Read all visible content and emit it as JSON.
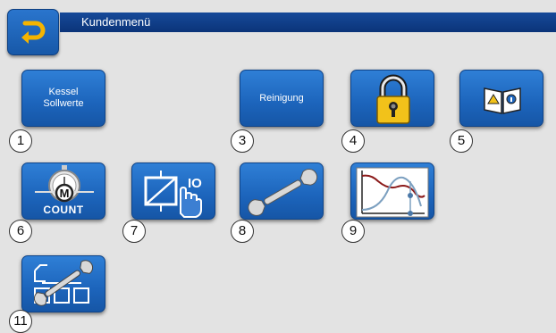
{
  "header": {
    "title": "Kundenmenü",
    "back_icon": "return-arrow-icon"
  },
  "tiles": [
    {
      "label": "Kessel\nSollwerte",
      "number": "1",
      "icon": null
    },
    {
      "label": "Reinigung",
      "number": "3",
      "icon": null
    },
    {
      "label": "",
      "number": "4",
      "icon": "padlock-icon"
    },
    {
      "label": "",
      "number": "5",
      "icon": "manual-book-icon"
    },
    {
      "label": "COUNT",
      "number": "6",
      "icon": "stopwatch-counter-icon",
      "badge": "M"
    },
    {
      "label": "IO",
      "number": "7",
      "icon": "relay-touch-icon"
    },
    {
      "label": "",
      "number": "8",
      "icon": "wrench-icon"
    },
    {
      "label": "",
      "number": "9",
      "icon": "curve-chart-icon"
    },
    {
      "label": "",
      "number": "11",
      "icon": "network-wrench-icon"
    }
  ],
  "colors": {
    "tile": "#1c64bb",
    "title_bar": "#0b3479",
    "background": "#e3e3e3",
    "lock_gold": "#f2c21a"
  }
}
